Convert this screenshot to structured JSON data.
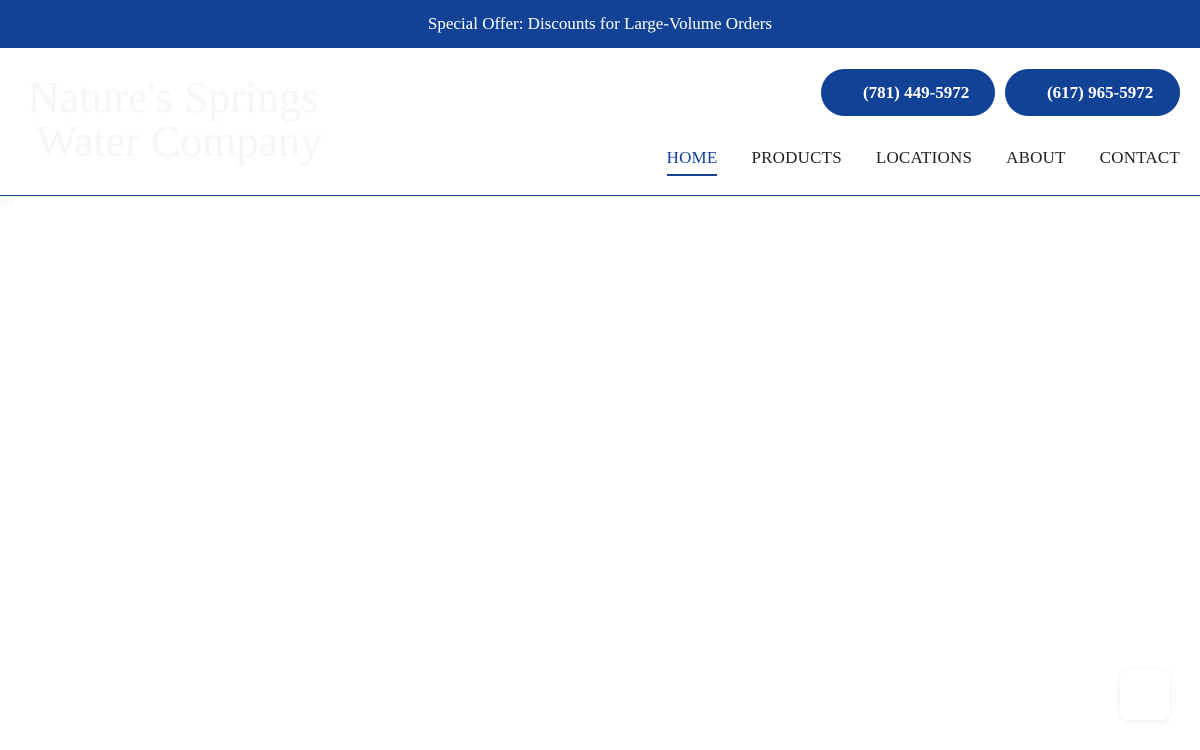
{
  "promo": {
    "text": "Special Offer: Discounts for Large-Volume Orders"
  },
  "logo": {
    "line1": "Nature's Springs",
    "line2": "Water Company"
  },
  "phones": [
    {
      "number": "(781) 449-5972",
      "icon": "phone-icon"
    },
    {
      "number": "(617) 965-5972",
      "icon": "phone-icon"
    }
  ],
  "nav": {
    "items": [
      {
        "label": "HOME",
        "active": true
      },
      {
        "label": "PRODUCTS",
        "active": false
      },
      {
        "label": "LOCATIONS",
        "active": false
      },
      {
        "label": "ABOUT",
        "active": false
      },
      {
        "label": "CONTACT",
        "active": false
      }
    ]
  },
  "colors": {
    "brand": "#124296",
    "background": "#ffffff",
    "nav_text": "#222222"
  },
  "chat": {
    "icon": "chat-widget-icon"
  }
}
